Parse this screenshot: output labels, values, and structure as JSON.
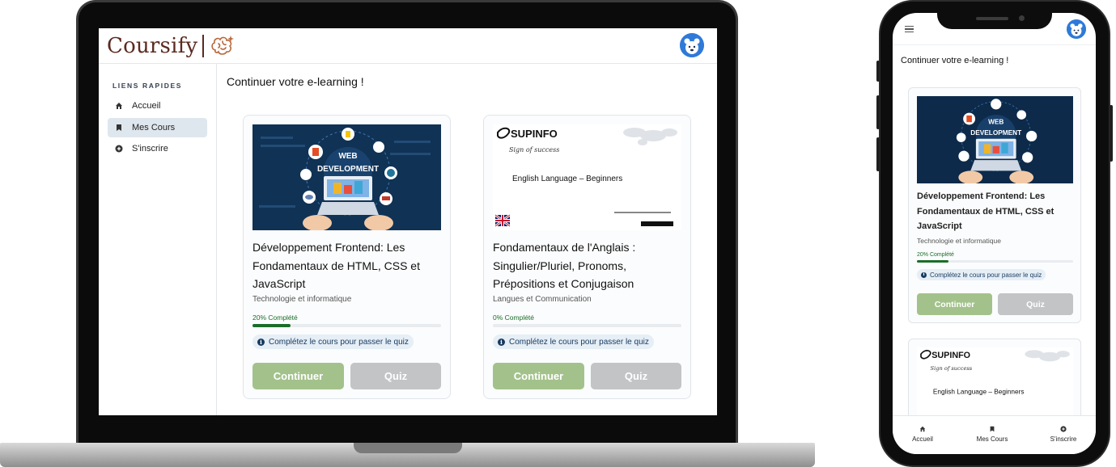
{
  "app": {
    "logo_text": "Coursify",
    "accent_color": "#5b2a20",
    "primary_green": "#a3c28b",
    "progress_green": "#1b6d2a"
  },
  "sidebar": {
    "section_title": "LIENS RAPIDES",
    "items": [
      {
        "label": "Accueil",
        "icon": "home-icon",
        "active": false
      },
      {
        "label": "Mes Cours",
        "icon": "bookmark-icon",
        "active": true
      },
      {
        "label": "S'inscrire",
        "icon": "add-circle-icon",
        "active": false
      }
    ]
  },
  "main": {
    "title": "Continuer votre e-learning !",
    "courses": [
      {
        "thumbnail_title_line1": "WEB",
        "thumbnail_title_line2": "DEVELOPMENT",
        "title": "Développement Frontend: Les Fondamentaux de HTML, CSS et JavaScript",
        "category": "Technologie et informatique",
        "progress_label": "20% Complété",
        "progress": 0.2,
        "quiz_note": "Complétez le cours pour passer le quiz",
        "continue_label": "Continuer",
        "quiz_label": "Quiz"
      },
      {
        "thumbnail_brand": "SUPINFO",
        "thumbnail_tagline": "Sign of success",
        "thumbnail_heading": "English Language – Beginners",
        "title": "Fondamentaux de l'Anglais : Singulier/Pluriel, Pronoms, Prépositions et Conjugaison",
        "category": "Langues et Communication",
        "progress_label": "0% Complété",
        "progress": 0.0,
        "quiz_note": "Complétez le cours pour passer le quiz",
        "continue_label": "Continuer",
        "quiz_label": "Quiz"
      }
    ]
  },
  "mobile": {
    "title": "Continuer votre e-learning !",
    "bottom_nav": [
      {
        "label": "Accueil",
        "icon": "home-icon"
      },
      {
        "label": "Mes Cours",
        "icon": "bookmark-icon"
      },
      {
        "label": "S'inscrire",
        "icon": "add-circle-icon"
      }
    ]
  }
}
